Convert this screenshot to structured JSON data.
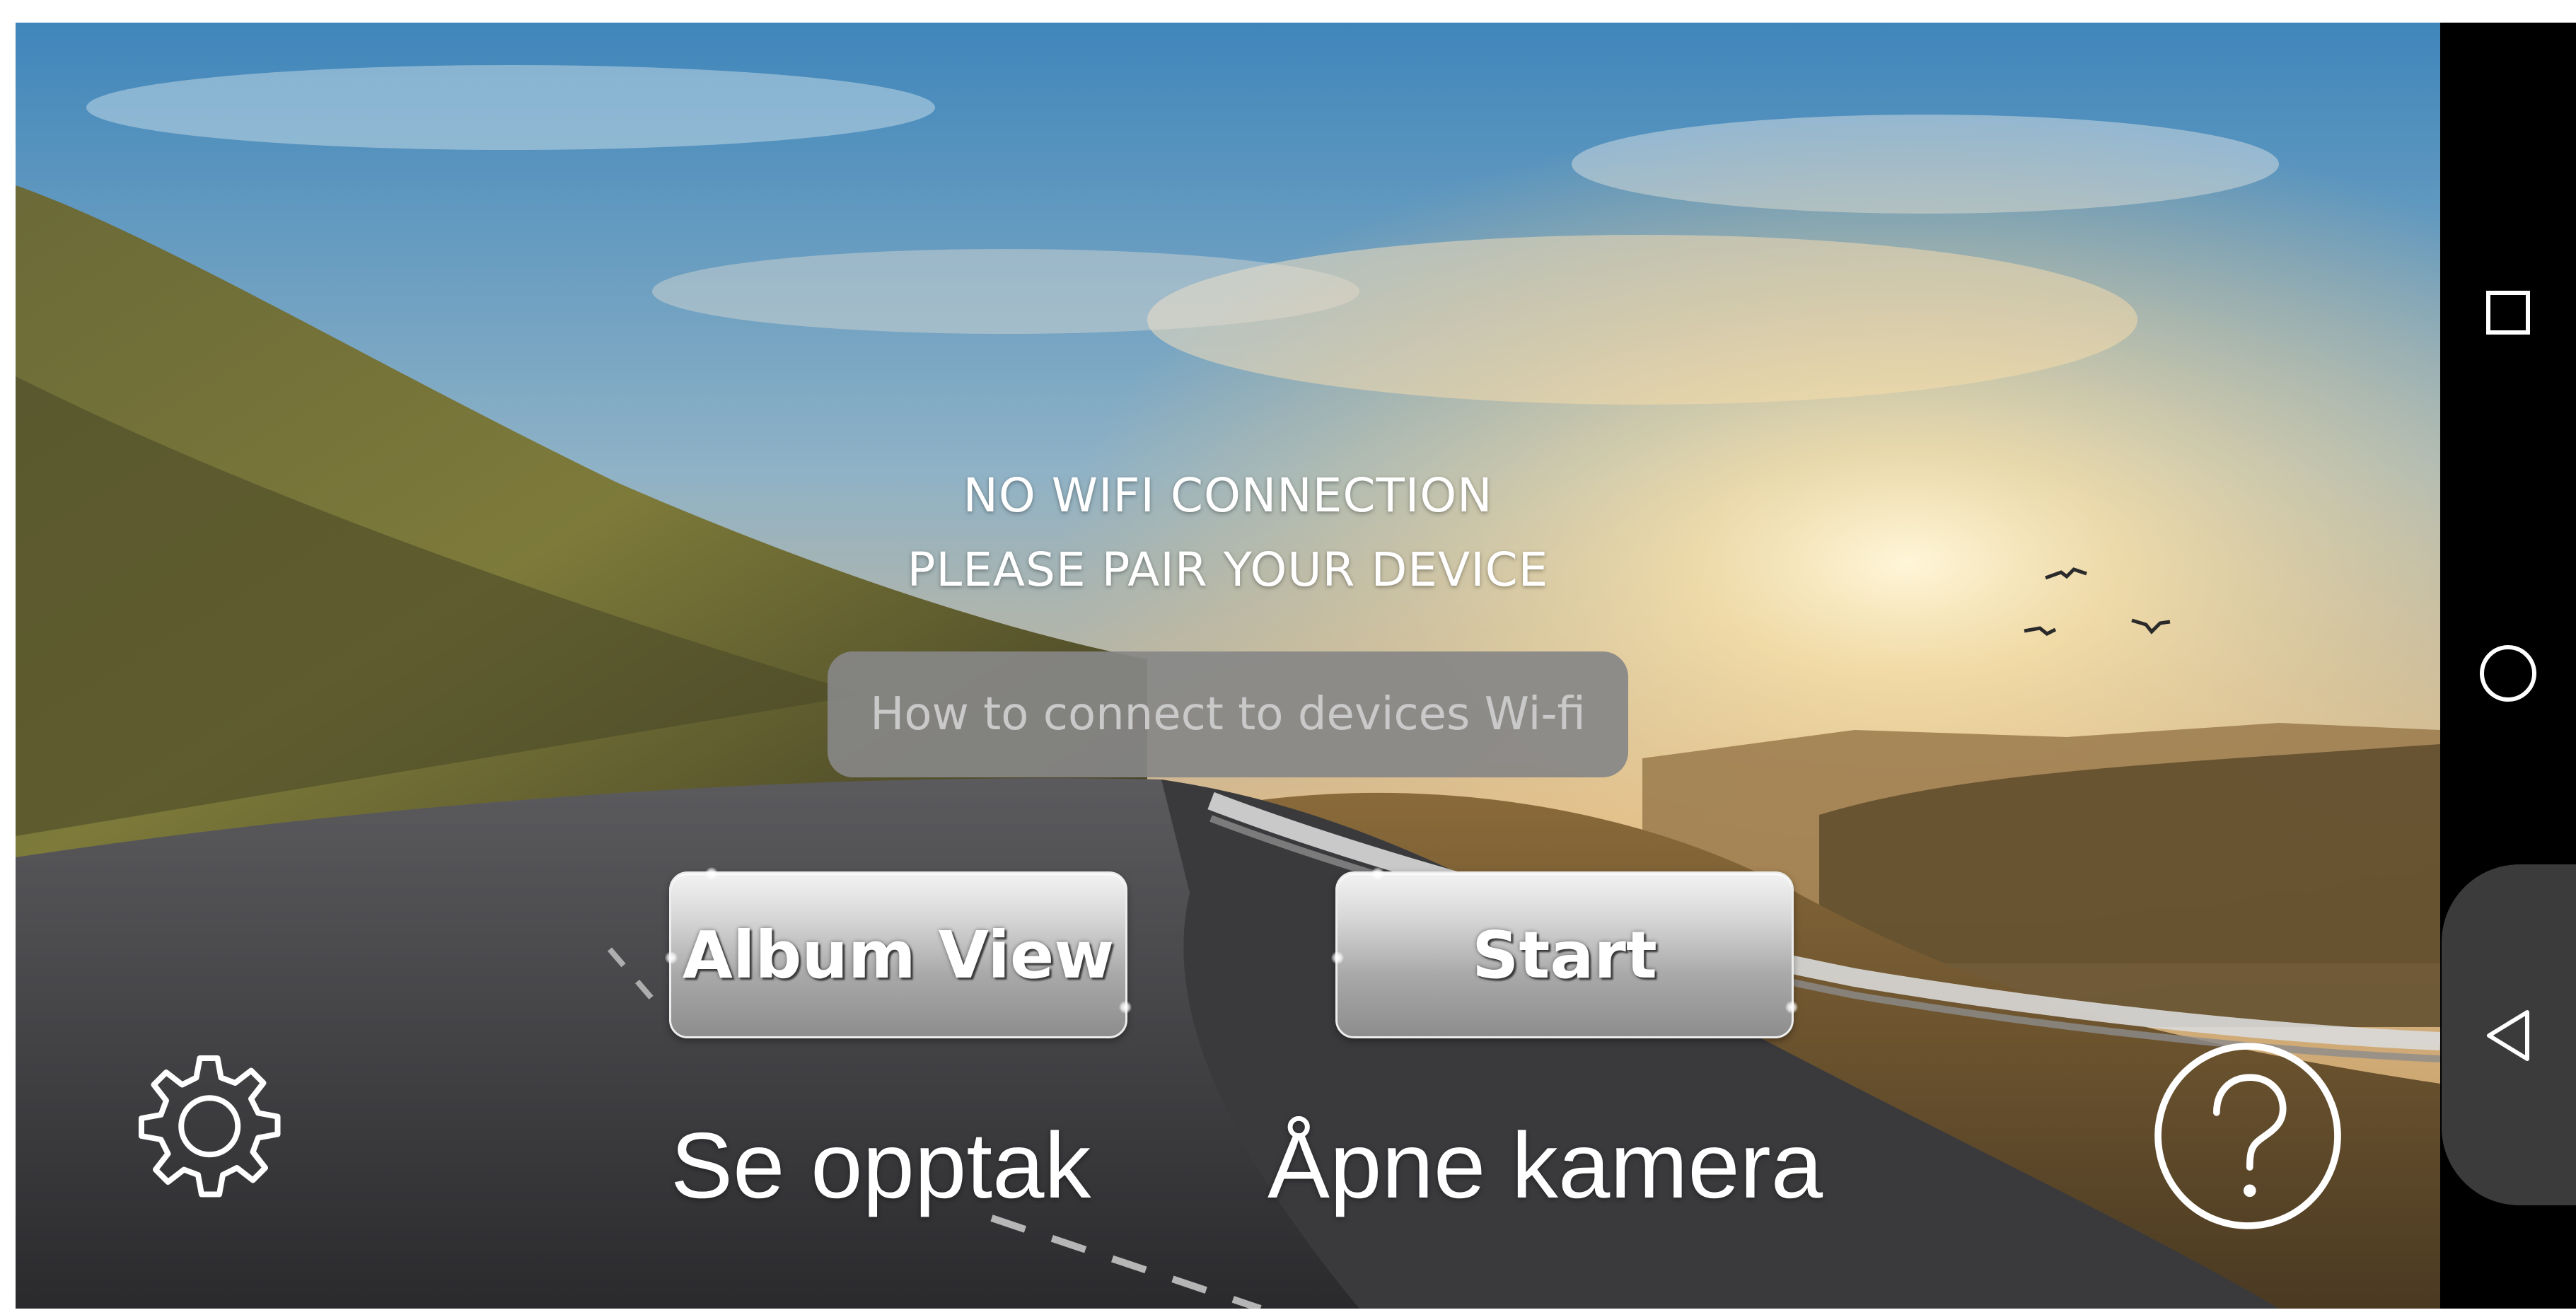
{
  "status": {
    "line1": "NO WIFI CONNECTION",
    "line2": "PLEASE PAIR YOUR DEVICE"
  },
  "howto_button": {
    "label": "How to connect to devices Wi-fi"
  },
  "buttons": {
    "album_view": "Album View",
    "start": "Start"
  },
  "labels": {
    "se_opptak": "Se opptak",
    "apne_kamera": "Åpne kamera"
  },
  "icons": {
    "settings": "gear-icon",
    "help": "question-mark-icon",
    "recents": "square-icon",
    "home": "circle-icon",
    "back": "triangle-back-icon"
  },
  "colors": {
    "navbar": "#000000",
    "howto_bg": "#878787",
    "text": "#ffffff"
  }
}
